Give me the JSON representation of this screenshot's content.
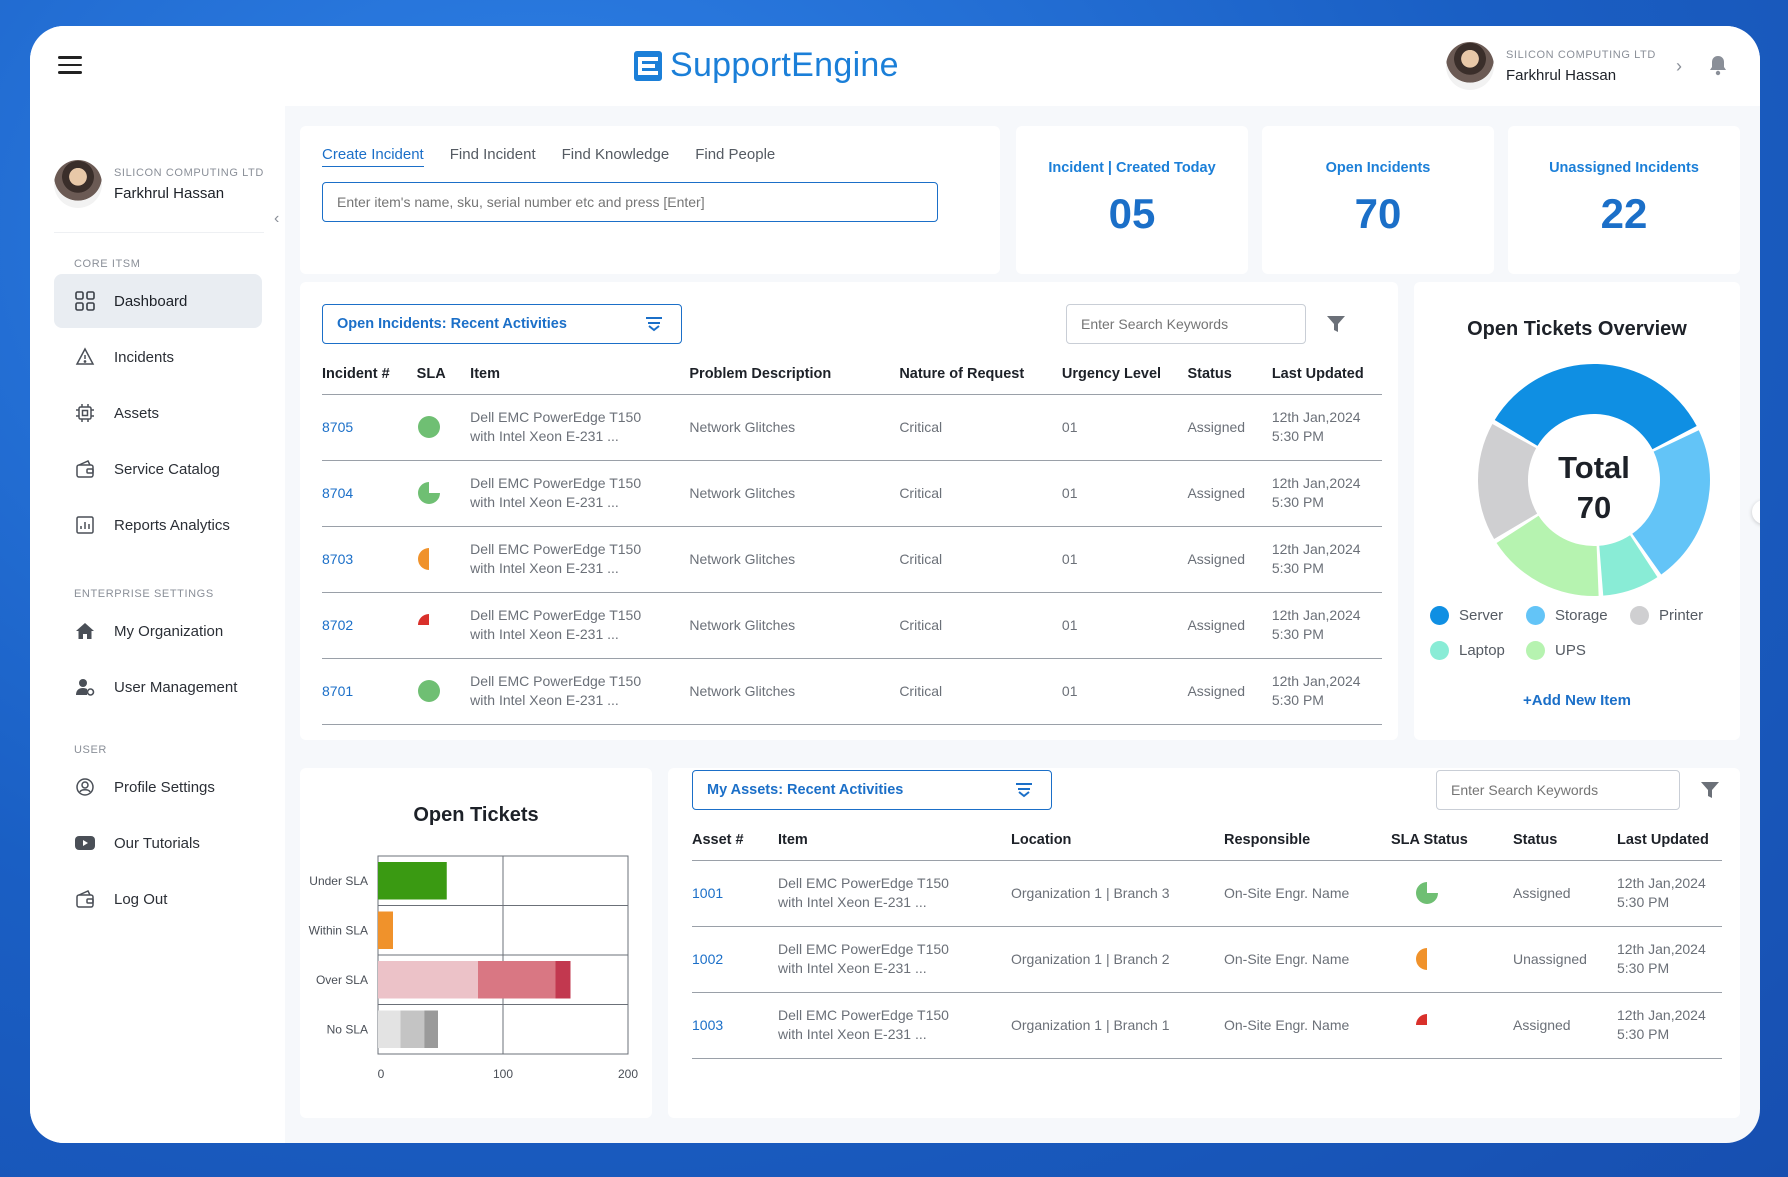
{
  "app": {
    "brand": "SupportEngine"
  },
  "user": {
    "company": "SILICON COMPUTING LTD",
    "name": "Farkhrul Hassan"
  },
  "sidebar": {
    "sections": {
      "core": "CORE ITSM",
      "enterprise": "ENTERPRISE SETTINGS",
      "user": "USER"
    },
    "items": [
      {
        "label": "Dashboard",
        "icon": "grid-icon"
      },
      {
        "label": "Incidents",
        "icon": "warning-icon"
      },
      {
        "label": "Assets",
        "icon": "chip-icon"
      },
      {
        "label": "Service Catalog",
        "icon": "wallet-icon"
      },
      {
        "label": "Reports Analytics",
        "icon": "chart-icon"
      },
      {
        "label": "My Organization",
        "icon": "home-icon"
      },
      {
        "label": "User Management",
        "icon": "user-gear-icon"
      },
      {
        "label": "Profile Settings",
        "icon": "profile-icon"
      },
      {
        "label": "Our Tutorials",
        "icon": "youtube-icon"
      },
      {
        "label": "Log Out",
        "icon": "logout-icon"
      }
    ]
  },
  "search": {
    "tabs": [
      "Create Incident",
      "Find Incident",
      "Find Knowledge",
      "Find People"
    ],
    "placeholder": "Enter item's name, sku, serial number etc and press [Enter]"
  },
  "stats": [
    {
      "title": "Incident | Created Today",
      "value": "05"
    },
    {
      "title": "Open Incidents",
      "value": "70"
    },
    {
      "title": "Unassigned Incidents",
      "value": "22"
    }
  ],
  "incidents": {
    "dropdown": "Open Incidents: Recent Activities",
    "search_placeholder": "Enter Search Keywords",
    "columns": [
      "Incident #",
      "SLA",
      "Item",
      "Problem Description",
      "Nature of Request",
      "Urgency Level",
      "Status",
      "Last Updated"
    ],
    "rows": [
      {
        "id": "8705",
        "sla": 1.0,
        "sla_color": "#6fbf73",
        "item1": "Dell EMC PowerEdge T150",
        "item2": "with Intel Xeon E-231 ...",
        "problem": "Network Glitches",
        "nature": "Critical",
        "urgency": "01",
        "status": "Assigned",
        "date": "12th Jan,2024",
        "time": "5:30 PM"
      },
      {
        "id": "8704",
        "sla": 0.75,
        "sla_color": "#6fbf73",
        "item1": "Dell EMC PowerEdge T150",
        "item2": "with Intel Xeon E-231 ...",
        "problem": "Network Glitches",
        "nature": "Critical",
        "urgency": "01",
        "status": "Assigned",
        "date": "12th Jan,2024",
        "time": "5:30 PM"
      },
      {
        "id": "8703",
        "sla": 0.5,
        "sla_color": "#f0922b",
        "item1": "Dell EMC PowerEdge T150",
        "item2": "with Intel Xeon E-231 ...",
        "problem": "Network Glitches",
        "nature": "Critical",
        "urgency": "01",
        "status": "Assigned",
        "date": "12th Jan,2024",
        "time": "5:30 PM"
      },
      {
        "id": "8702",
        "sla": 0.25,
        "sla_color": "#d9302b",
        "item1": "Dell EMC PowerEdge T150",
        "item2": "with Intel Xeon E-231 ...",
        "problem": "Network Glitches",
        "nature": "Critical",
        "urgency": "01",
        "status": "Assigned",
        "date": "12th Jan,2024",
        "time": "5:30 PM"
      },
      {
        "id": "8701",
        "sla": 1.0,
        "sla_color": "#6fbf73",
        "item1": "Dell EMC PowerEdge T150",
        "item2": "with Intel Xeon E-231 ...",
        "problem": "Network Glitches",
        "nature": "Critical",
        "urgency": "01",
        "status": "Assigned",
        "date": "12th Jan,2024",
        "time": "5:30 PM"
      }
    ]
  },
  "overview": {
    "title": "Open Tickets Overview",
    "center_top": "Total",
    "center_bottom": "70",
    "add_label": "+Add New Item",
    "legend": [
      {
        "name": "Server",
        "color": "#0f8fe3"
      },
      {
        "name": "Storage",
        "color": "#63c4f7"
      },
      {
        "name": "Printer",
        "color": "#cfcfd1"
      },
      {
        "name": "Laptop",
        "color": "#89ecd6"
      },
      {
        "name": "UPS",
        "color": "#b6f3b0"
      }
    ]
  },
  "assets": {
    "dropdown": "My Assets: Recent Activities",
    "search_placeholder": "Enter Search Keywords",
    "columns": [
      "Asset #",
      "Item",
      "Location",
      "Responsible",
      "SLA Status",
      "Status",
      "Last Updated"
    ],
    "rows": [
      {
        "id": "1001",
        "item1": "Dell EMC PowerEdge T150",
        "item2": "with Intel Xeon E-231 ...",
        "location": "Organization 1 | Branch 3",
        "responsible": "On-Site Engr. Name",
        "sla": 0.75,
        "sla_color": "#6fbf73",
        "status": "Assigned",
        "date": "12th Jan,2024",
        "time": "5:30 PM"
      },
      {
        "id": "1002",
        "item1": "Dell EMC PowerEdge T150",
        "item2": "with Intel Xeon E-231 ...",
        "location": "Organization 1 | Branch 2",
        "responsible": "On-Site Engr. Name",
        "sla": 0.5,
        "sla_color": "#f0922b",
        "status": "Unassigned",
        "date": "12th Jan,2024",
        "time": "5:30 PM"
      },
      {
        "id": "1003",
        "item1": "Dell EMC PowerEdge T150",
        "item2": "with Intel Xeon E-231 ...",
        "location": "Organization 1 | Branch 1",
        "responsible": "On-Site Engr. Name",
        "sla": 0.25,
        "sla_color": "#d9302b",
        "status": "Assigned",
        "date": "12th Jan,2024",
        "time": "5:30 PM"
      }
    ]
  },
  "chart_data": [
    {
      "type": "pie",
      "title": "Open Tickets Overview",
      "categories": [
        "Server",
        "Storage",
        "Laptop",
        "UPS",
        "Printer"
      ],
      "values": [
        24,
        16,
        6,
        12,
        12
      ],
      "total": 70,
      "colors": [
        "#0f8fe3",
        "#63c4f7",
        "#89ecd6",
        "#b6f3b0",
        "#cfcfd1"
      ]
    },
    {
      "type": "bar",
      "title": "Open Tickets",
      "orientation": "horizontal",
      "stacked": true,
      "categories": [
        "Under SLA",
        "Within SLA",
        "Over SLA",
        "No SLA"
      ],
      "segments": [
        [
          {
            "value": 55,
            "color": "#3a9a12"
          }
        ],
        [
          {
            "value": 12,
            "color": "#f0922b"
          }
        ],
        [
          {
            "value": 80,
            "color": "#ecc2c8"
          },
          {
            "value": 62,
            "color": "#d97783"
          },
          {
            "value": 12,
            "color": "#c2384f"
          }
        ],
        [
          {
            "value": 18,
            "color": "#e3e3e3"
          },
          {
            "value": 19,
            "color": "#c4c4c4"
          },
          {
            "value": 11,
            "color": "#9a9a9a"
          }
        ]
      ],
      "xlim": [
        0,
        200
      ],
      "xticks": [
        "0",
        "100",
        "200"
      ],
      "grid": true
    }
  ]
}
